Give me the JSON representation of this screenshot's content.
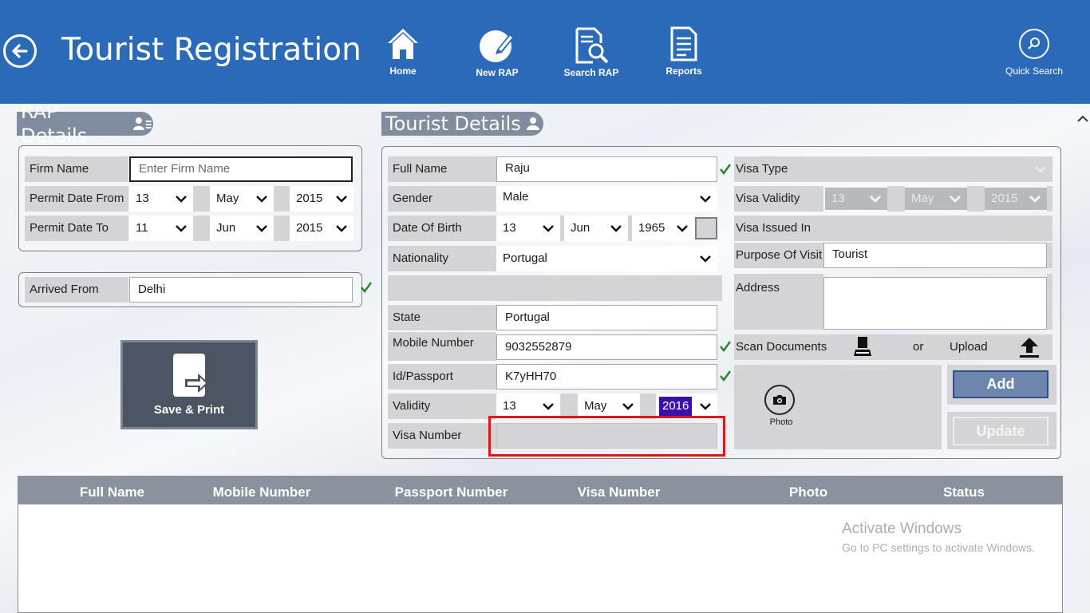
{
  "header": {
    "title": "Tourist Registration",
    "nav": [
      {
        "label": "Home",
        "icon": "home-icon"
      },
      {
        "label": "New RAP",
        "icon": "edit-icon"
      },
      {
        "label": "Search RAP",
        "icon": "document-search-icon"
      },
      {
        "label": "Reports",
        "icon": "reports-icon"
      }
    ],
    "quick_search": "Quick Search"
  },
  "rap_details": {
    "title": "RAP Details",
    "firm_name_label": "Firm Name",
    "firm_name_placeholder": "Enter Firm Name",
    "permit_from_label": "Permit Date From",
    "permit_from": {
      "day": "13",
      "month": "May",
      "year": "2015"
    },
    "permit_to_label": "Permit Date To",
    "permit_to": {
      "day": "11",
      "month": "Jun",
      "year": "2015"
    },
    "arrived_from_label": "Arrived From",
    "arrived_from": "Delhi",
    "save_print": "Save & Print"
  },
  "tourist_details": {
    "title": "Tourist Details",
    "full_name_label": "Full Name",
    "full_name": "Raju",
    "gender_label": "Gender",
    "gender": "Male",
    "dob_label": "Date Of Birth",
    "dob": {
      "day": "13",
      "month": "Jun",
      "year": "1965"
    },
    "nationality_label": "Nationality",
    "nationality": "Portugal",
    "state_label": "State",
    "state": "Portugal",
    "mobile_label": "Mobile Number",
    "mobile": "9032552879",
    "id_label": "Id/Passport",
    "id": "K7yHH70",
    "validity_label": "Validity",
    "validity": {
      "day": "13",
      "month": "May",
      "year": "2016"
    },
    "visa_number_label": "Visa Number",
    "visa_type_label": "Visa Type",
    "visa_validity_label": "Visa Validity",
    "visa_validity": {
      "day": "13",
      "month": "May",
      "year": "2015"
    },
    "visa_issued_label": "Visa Issued In",
    "purpose_label": "Purpose Of Visit",
    "purpose": "Tourist",
    "address_label": "Address",
    "scan_label": "Scan Documents",
    "or_label": "or",
    "upload_label": "Upload",
    "photo_label": "Photo",
    "add_label": "Add",
    "update_label": "Update"
  },
  "grid": {
    "columns": [
      "Full Name",
      "Mobile Number",
      "Passport Number",
      "Visa Number",
      "Photo",
      "Status"
    ]
  },
  "watermark": {
    "line1": "Activate Windows",
    "line2": "Go to PC settings to activate Windows."
  },
  "colors": {
    "topbar": "#2a6ab9",
    "section_header": "#808d9e",
    "check": "#1e8a1e",
    "selected_year": "#3b0fa8",
    "highlight": "#e0161b"
  }
}
